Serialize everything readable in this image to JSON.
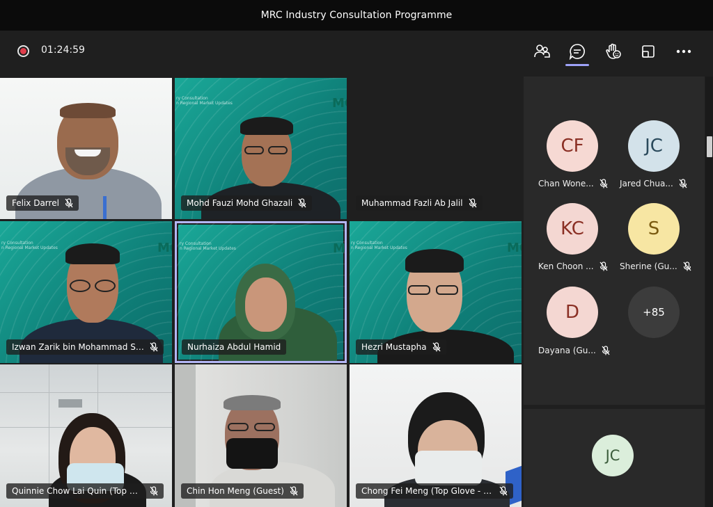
{
  "window": {
    "title": "MRC Industry Consultation Programme"
  },
  "toolbar": {
    "timer": "01:24:59",
    "icons": [
      "people-icon",
      "chat-icon",
      "raise-hand-icon",
      "share-tray-icon",
      "more-icon"
    ],
    "active_color": "#9ea2f8"
  },
  "tiles": [
    {
      "name": "Felix Darrel"
    },
    {
      "name": "Mohd Fauzi Mohd Ghazali"
    },
    {
      "name": "Muhammad Fazli Ab Jalil"
    },
    {
      "name": "Izwan Zarik bin Mohammad Sa..."
    },
    {
      "name": "Nurhaiza Abdul Hamid"
    },
    {
      "name": "Hezri Mustapha"
    },
    {
      "name": "Quinnie Chow Lai Quin (Top Gl..."
    },
    {
      "name": "Chin Hon Meng (Guest)"
    },
    {
      "name": "Chong Fei Meng (Top Glove - F..."
    }
  ],
  "background_text": {
    "line1": "ry Consultation",
    "line2": "n Regional Market Updates",
    "brand": "MC"
  },
  "side_participants": [
    {
      "initials": "CF",
      "label": "Chan Wone...",
      "bg": "#f6d9d3",
      "fg": "#8a2f24"
    },
    {
      "initials": "JC",
      "label": "Jared Chua...",
      "bg": "#d3e2ea",
      "fg": "#2b4a5c"
    },
    {
      "initials": "KC",
      "label": "Ken Choon ...",
      "bg": "#f4d7d2",
      "fg": "#8a2f24"
    },
    {
      "initials": "S",
      "label": "Sherine (Gu...",
      "bg": "#f7e6a3",
      "fg": "#7a5a10"
    },
    {
      "initials": "D",
      "label": "Dayana (Gu...",
      "bg": "#f4d7d2",
      "fg": "#8a2f24"
    },
    {
      "initials": "+85",
      "label": "",
      "bg": "#3c3c3c",
      "fg": "#ffffff"
    }
  ],
  "self_view": {
    "initials": "JC",
    "bg": "#dbeedb",
    "fg": "#3b5c3b"
  }
}
